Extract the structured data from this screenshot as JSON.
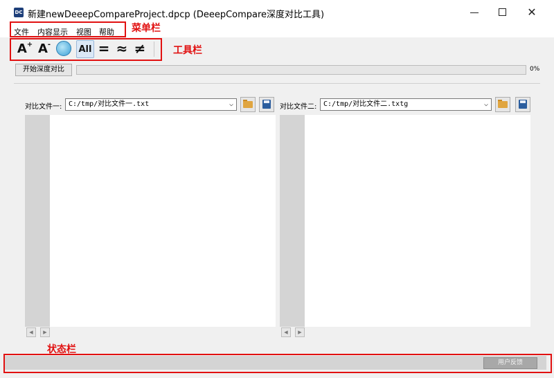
{
  "window": {
    "title": "新建newDeeepCompareProject.dpcp  (DeeepCompare深度对比工具)",
    "app_icon_text": "DC",
    "minimize_label": "",
    "maximize_label": "",
    "close_label": "✕"
  },
  "menu": {
    "items": [
      "文件",
      "内容显示",
      "视图",
      "帮助"
    ]
  },
  "toolbar": {
    "font_increase": "A",
    "font_increase_sup": "+",
    "font_decrease": "A",
    "font_decrease_sup": "-",
    "all": "All",
    "equal": "=",
    "similar": "≈",
    "not_equal": "≠",
    "filter_icon": "filter-circle-icon"
  },
  "annotations": {
    "menubar": "菜单栏",
    "toolbar": "工具栏",
    "statusbar": "状态栏",
    "color": "#e11010"
  },
  "action": {
    "start_button": "开始深度对比",
    "progress_percent": 0,
    "progress_text": "0%"
  },
  "left_pane": {
    "label": "对比文件一:",
    "path": "C:/tmp/对比文件一.txt"
  },
  "right_pane": {
    "label": "对比文件二:",
    "path": "C:/tmp/对比文件二.txtg"
  },
  "status": {
    "feedback_button": "用户反馈"
  },
  "colors": {
    "window_bg": "#f0f0f0",
    "gutter": "#d4d4d4",
    "statusbar": "#d4d4d4"
  }
}
